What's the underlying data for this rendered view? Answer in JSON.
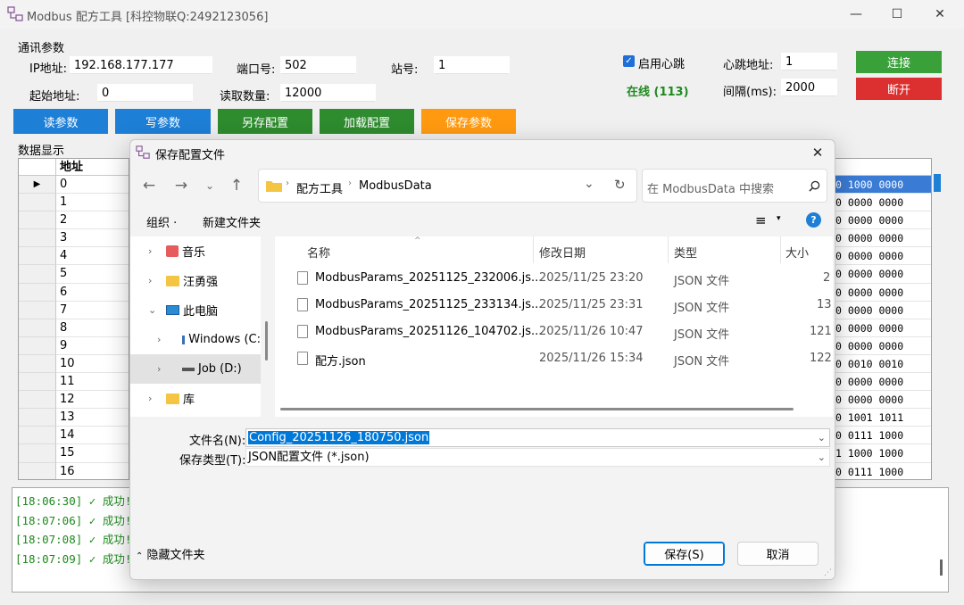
{
  "window": {
    "title": "Modbus 配方工具 [科控物联Q:2492123056]",
    "controls": {
      "minimize": "—",
      "maximize": "☐",
      "close": "✕"
    }
  },
  "comm": {
    "group_label": "通讯参数",
    "ip_label": "IP地址:",
    "ip_value": "192.168.177.177",
    "port_label": "端口号:",
    "port_value": "502",
    "station_label": "站号:",
    "station_value": "1",
    "start_label": "起始地址:",
    "start_value": "0",
    "count_label": "读取数量:",
    "count_value": "12000",
    "heartbeat_enable_label": "启用心跳",
    "heartbeat_addr_label": "心跳地址:",
    "heartbeat_addr_value": "1",
    "interval_label": "间隔(ms):",
    "interval_value": "2000",
    "online_status": "在线 (113)",
    "connect_label": "连接",
    "disconnect_label": "断开"
  },
  "actions": {
    "read": "读参数",
    "write": "写参数",
    "save_as": "另存配置",
    "load": "加载配置",
    "save_params": "保存参数"
  },
  "grid": {
    "section_label": "数据显示",
    "col_address": "地址",
    "rows": [
      "0",
      "1",
      "2",
      "3",
      "4",
      "5",
      "6",
      "7",
      "8",
      "9",
      "10",
      "11",
      "12",
      "13",
      "14",
      "15",
      "16"
    ],
    "binary_tail": [
      "0 1000 0000",
      "0 0000 0000",
      "0 0000 0000",
      "0 0000 0000",
      "0 0000 0000",
      "0 0000 0000",
      "0 0000 0000",
      "0 0000 0000",
      "0 0000 0000",
      "0 0000 0000",
      "0 0010 0010",
      "0 0000 0000",
      "0 0000 0000",
      "0 1001 1011",
      "0 0111 1000",
      "1 1000 1000",
      "0 0111 1000"
    ]
  },
  "log": {
    "lines": [
      "[18:06:30] ✓ 成功!",
      "[18:07:06] ✓ 成功!",
      "[18:07:08] ✓ 成功!",
      "[18:07:09] ✓ 成功!"
    ]
  },
  "dialog": {
    "title": "保存配置文件",
    "close": "✕",
    "breadcrumb": [
      "配方工具",
      "ModbusData"
    ],
    "search_placeholder": "在 ModbusData 中搜索",
    "organize": "组织 ·",
    "new_folder": "新建文件夹",
    "nav_items": [
      "音乐",
      "汪勇强",
      "此电脑",
      "Windows (C:",
      "Job (D:)",
      "库"
    ],
    "columns": {
      "name": "名称",
      "modified": "修改日期",
      "type": "类型",
      "size": "大小"
    },
    "files": [
      {
        "name": "ModbusParams_20251125_232006.js...",
        "modified": "2025/11/25 23:20",
        "type": "JSON 文件",
        "size": "2"
      },
      {
        "name": "ModbusParams_20251125_233134.js...",
        "modified": "2025/11/25 23:31",
        "type": "JSON 文件",
        "size": "13"
      },
      {
        "name": "ModbusParams_20251126_104702.js...",
        "modified": "2025/11/26 10:47",
        "type": "JSON 文件",
        "size": "121"
      },
      {
        "name": "配方.json",
        "modified": "2025/11/26 15:34",
        "type": "JSON 文件",
        "size": "122"
      }
    ],
    "filename_label": "文件名(N):",
    "filename_value": "Config_20251126_180750.json",
    "filetype_label": "保存类型(T):",
    "filetype_value": "JSON配置文件 (*.json)",
    "hide_folders": "隐藏文件夹",
    "save": "保存(S)",
    "cancel": "取消"
  },
  "colors": {
    "blue_button": "#1e7fd6",
    "green_button": "#2e8b2e",
    "orange_button": "#ff9a10",
    "red_button": "#dc2f2f",
    "connect_green": "#3aa13a",
    "online_text": "#1f8a1f",
    "log_text": "#1d8a1d",
    "selection": "#0078d7"
  }
}
